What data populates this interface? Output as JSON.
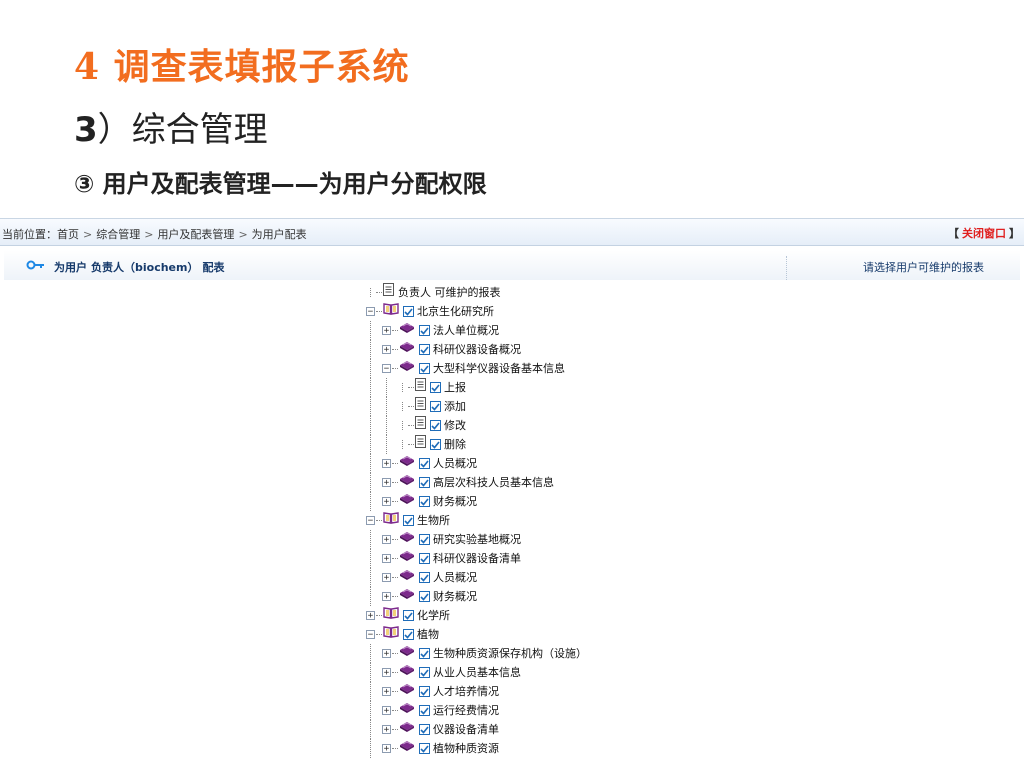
{
  "slide": {
    "title": "4 调查表填报子系统",
    "subtitle_num": "3",
    "subtitle_text": "）综合管理",
    "subtitle2": "③ 用户及配表管理——为用户分配权限"
  },
  "breadcrumb": {
    "label": "当前位置：",
    "items": [
      "首页",
      "综合管理",
      "用户及配表管理",
      "为用户配表"
    ],
    "sep": ">"
  },
  "close_window": {
    "open": "【",
    "label": "关闭窗口",
    "close": "】"
  },
  "panel": {
    "title_parts": [
      "为用户",
      "负责人（biochem）",
      "配表"
    ],
    "hint": "请选择用户可维护的报表"
  },
  "colors": {
    "accent": "#f26d1f",
    "link_red": "#e02020",
    "book": "#7d2a8c",
    "check": "#1f6cb8"
  },
  "tree": [
    {
      "label": "负责人 可维护的报表",
      "type": "doc",
      "checkbox": false,
      "level": 0,
      "expander": "none"
    },
    {
      "label": "北京生化研究所",
      "type": "book",
      "checkbox": true,
      "level": 0,
      "expander": "minus"
    },
    {
      "label": "法人单位概况",
      "type": "cube",
      "checkbox": true,
      "level": 1,
      "expander": "plus"
    },
    {
      "label": "科研仪器设备概况",
      "type": "cube",
      "checkbox": true,
      "level": 1,
      "expander": "plus"
    },
    {
      "label": "大型科学仪器设备基本信息",
      "type": "cube",
      "checkbox": true,
      "level": 1,
      "expander": "minus"
    },
    {
      "label": "上报",
      "type": "doc",
      "checkbox": true,
      "level": 2,
      "expander": "none"
    },
    {
      "label": "添加",
      "type": "doc",
      "checkbox": true,
      "level": 2,
      "expander": "none"
    },
    {
      "label": "修改",
      "type": "doc",
      "checkbox": true,
      "level": 2,
      "expander": "none"
    },
    {
      "label": "删除",
      "type": "doc",
      "checkbox": true,
      "level": 2,
      "expander": "none"
    },
    {
      "label": "人员概况",
      "type": "cube",
      "checkbox": true,
      "level": 1,
      "expander": "plus"
    },
    {
      "label": "高层次科技人员基本信息",
      "type": "cube",
      "checkbox": true,
      "level": 1,
      "expander": "plus"
    },
    {
      "label": "财务概况",
      "type": "cube",
      "checkbox": true,
      "level": 1,
      "expander": "plus"
    },
    {
      "label": "生物所",
      "type": "book",
      "checkbox": true,
      "level": 0,
      "expander": "minus"
    },
    {
      "label": "研究实验基地概况",
      "type": "cube",
      "checkbox": true,
      "level": 1,
      "expander": "plus"
    },
    {
      "label": "科研仪器设备清单",
      "type": "cube",
      "checkbox": true,
      "level": 1,
      "expander": "plus"
    },
    {
      "label": "人员概况",
      "type": "cube",
      "checkbox": true,
      "level": 1,
      "expander": "plus"
    },
    {
      "label": "财务概况",
      "type": "cube",
      "checkbox": true,
      "level": 1,
      "expander": "plus"
    },
    {
      "label": "化学所",
      "type": "book",
      "checkbox": true,
      "level": 0,
      "expander": "plus"
    },
    {
      "label": "植物",
      "type": "book",
      "checkbox": true,
      "level": 0,
      "expander": "minus"
    },
    {
      "label": "生物种质资源保存机构（设施）",
      "type": "cube",
      "checkbox": true,
      "level": 1,
      "expander": "plus"
    },
    {
      "label": "从业人员基本信息",
      "type": "cube",
      "checkbox": true,
      "level": 1,
      "expander": "plus"
    },
    {
      "label": "人才培养情况",
      "type": "cube",
      "checkbox": true,
      "level": 1,
      "expander": "plus"
    },
    {
      "label": "运行经费情况",
      "type": "cube",
      "checkbox": true,
      "level": 1,
      "expander": "plus"
    },
    {
      "label": "仪器设备清单",
      "type": "cube",
      "checkbox": true,
      "level": 1,
      "expander": "plus"
    },
    {
      "label": "植物种质资源",
      "type": "cube",
      "checkbox": true,
      "level": 1,
      "expander": "plus"
    }
  ]
}
